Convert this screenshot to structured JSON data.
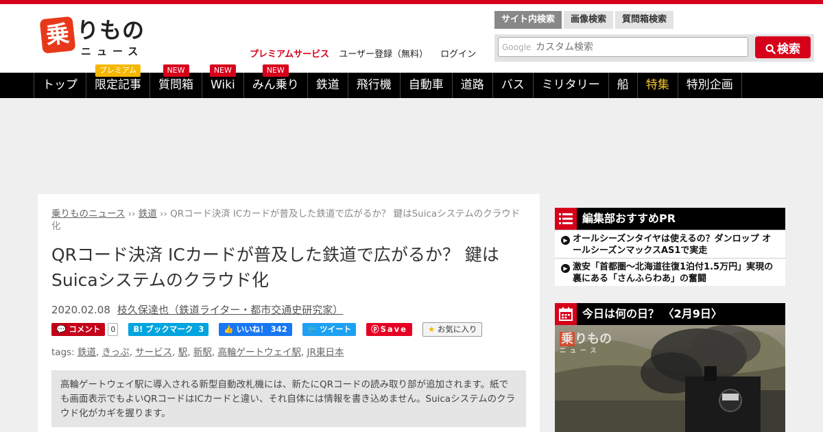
{
  "logo": {
    "kanji": "乗",
    "kana": "りもの",
    "news": "ニュース"
  },
  "header_links": {
    "premium": "プレミアムサービス",
    "register": "ユーザー登録（無料）",
    "login": "ログイン"
  },
  "search": {
    "tabs": [
      "サイト内検索",
      "画像検索",
      "質問箱検索"
    ],
    "google_mark": "Google",
    "placeholder": "カスタム検索",
    "button_label": "検索"
  },
  "nav": [
    {
      "label": "トップ"
    },
    {
      "label": "限定記事",
      "badge": "プレミアム"
    },
    {
      "label": "質問箱",
      "badge": "NEW"
    },
    {
      "label": "Wiki",
      "badge": "NEW"
    },
    {
      "label": "みん乗り",
      "badge": "NEW"
    },
    {
      "label": "鉄道"
    },
    {
      "label": "飛行機"
    },
    {
      "label": "自動車"
    },
    {
      "label": "道路"
    },
    {
      "label": "バス"
    },
    {
      "label": "ミリタリー"
    },
    {
      "label": "船"
    },
    {
      "label": "特集"
    },
    {
      "label": "特別企画"
    }
  ],
  "breadcrumb": {
    "home": "乗りものニュース",
    "sep": " ›› ",
    "category": "鉄道",
    "current": "QRコード決済 ICカードが普及した鉄道で広がるか？ 鍵はSuicaシステムのクラウド化"
  },
  "article": {
    "title": "QRコード決済 ICカードが普及した鉄道で広がるか？ 鍵はSuicaシステムのクラウド化",
    "date": "2020.02.08",
    "author": "枝久保達也（鉄道ライター・都市交通史研究家）",
    "share": {
      "comment_label": "コメント",
      "comment_count": "0",
      "hatena_label": "B! ブックマーク",
      "hatena_count": "3",
      "like_label": "いいね！",
      "like_count": "342",
      "tweet_label": "ツイート",
      "save_label": "Save",
      "fav_label": "お気に入り"
    },
    "tags_label": "tags:",
    "tags": [
      "鉄道",
      "きっぷ",
      "サービス",
      "駅",
      "新駅",
      "高輪ゲートウェイ駅",
      "JR東日本"
    ],
    "lead": "高輪ゲートウェイ駅に導入される新型自動改札機には、新たにQRコードの読み取り部が追加されます。紙でも画面表示でもよいQRコードはICカードと違い、それ自体には情報を書き込めません。Suicaシステムのクラウド化がカギを握ります。"
  },
  "sidebar": {
    "pr_title": "編集部おすすめPR",
    "pr_items": [
      "オールシーズンタイヤは使えるの？ダンロップ オールシーズンマックスAS1で実走",
      "激安「首都圏～北海道往復1泊付1.5万円」実現の裏にある「さんふらわあ」の奮闘"
    ],
    "today_title": "今日は何の日？ 〈2月9日〉",
    "photo_logo": {
      "kanji": "乗",
      "kana": "りもの",
      "news": "ニュース"
    }
  },
  "colors": {
    "brand": "#d7001a",
    "nav_bg": "#000000",
    "feature": "#f5c431"
  }
}
